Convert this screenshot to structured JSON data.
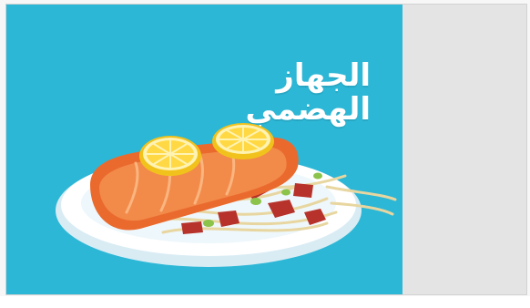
{
  "hero": {
    "title": "الجهاز الهضمي",
    "background_color": "#2cb7d6",
    "image_icon": "salmon-pasta-dish-illustration"
  },
  "side_panel": {
    "background_color": "#e4e4e4"
  }
}
